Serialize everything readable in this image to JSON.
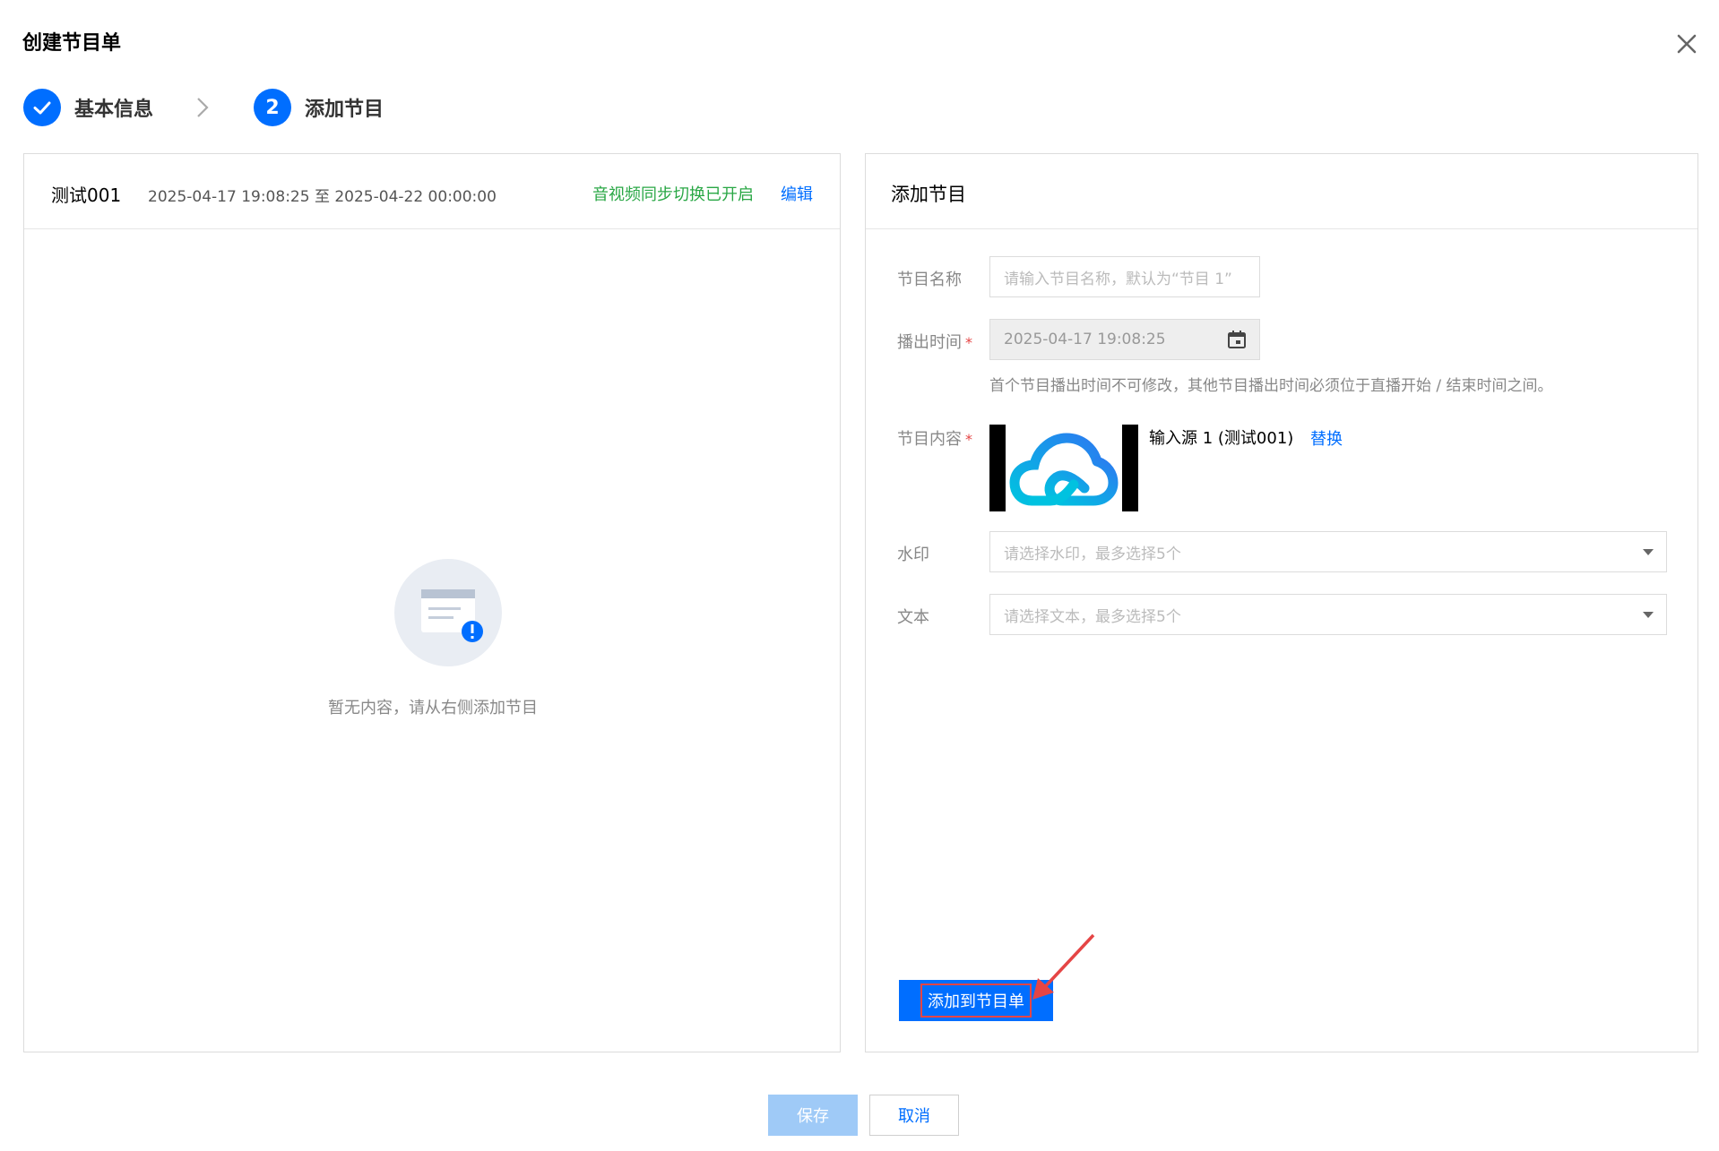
{
  "dialog": {
    "title": "创建节目单"
  },
  "steps": [
    {
      "number": "",
      "label": "基本信息",
      "state": "done"
    },
    {
      "number": "2",
      "label": "添加节目",
      "state": "active"
    }
  ],
  "left_panel": {
    "name": "测试001",
    "time_range": "2025-04-17 19:08:25 至 2025-04-22 00:00:00",
    "sync_status": "音视频同步切换已开启",
    "edit_link": "编辑",
    "empty_text": "暂无内容，请从右侧添加节目"
  },
  "right_panel": {
    "title": "添加节目",
    "fields": {
      "name_label": "节目名称",
      "name_placeholder": "请输入节目名称，默认为“节目 1”",
      "time_label": "播出时间",
      "time_value": "2025-04-17 19:08:25",
      "time_hint": "首个节目播出时间不可修改，其他节目播出时间必须位于直播开始 / 结束时间之间。",
      "content_label": "节目内容",
      "content_source": "输入源 1 (测试001)",
      "replace_link": "替换",
      "watermark_label": "水印",
      "watermark_placeholder": "请选择水印，最多选择5个",
      "text_label": "文本",
      "text_placeholder": "请选择文本，最多选择5个",
      "required_mark": "*"
    },
    "add_button": "添加到节目单"
  },
  "footer": {
    "save": "保存",
    "cancel": "取消"
  },
  "colors": {
    "primary": "#006eff",
    "success": "#29a745",
    "highlight": "#e54545"
  }
}
